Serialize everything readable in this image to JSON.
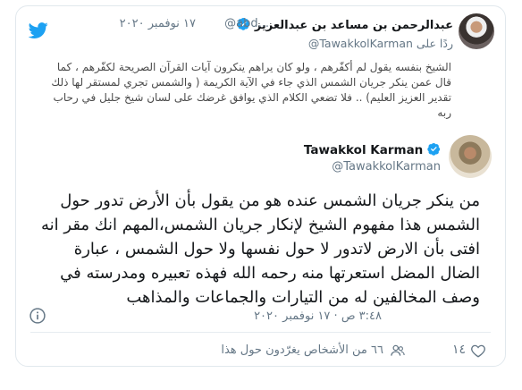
{
  "quoted": {
    "author_name": "عبدالرحمن بن مساعد بن عبدالعزيز",
    "handle": "@abd...",
    "time": "١٧ نوفمبر ٢٠٢٠",
    "replying_label": "ردًا على",
    "replying_handle": "@TawakkolKarman",
    "text": "الشيخ بنفسه يقول لم أكفّرهم ، ولو كان يراهم ينكرون آيات القرآن الصريحة لكفّرهم ، كما قال عمن ينكر جريان الشمس الذي جاء في الآية الكريمة ( والشمس تجري لمستقر لها ذلك تقدير العزيز العليم) .. فلا تضعي الكلام الذي يوافق غرضك على لسان شيخ جليل في رحاب ربه"
  },
  "tweet": {
    "author_name": "Tawakkol Karman",
    "handle": "@TawakkolKarman",
    "text": "من ينكر جريان الشمس عنده هو من يقول بأن الأرض تدور حول الشمس هذا مفهوم الشيخ لإنكار جريان الشمس،المهم انك مقر انه افتى بأن الارض لاتدور لا حول نفسها ولا حول الشمس ، عبارة الضال المضل استعرتها منه رحمه الله فهذه تعبيره ومدرسته في وصف المخالفين له من التيارات والجماعات والمذاهب",
    "time": "٣:٤٨ ص · ١٧ نوفمبر ٢٠٢٠"
  },
  "actions": {
    "likes": "١٤",
    "people_talking": "٦٦ من الأشخاص يغرّدون حول هذا"
  },
  "colors": {
    "accent": "#1da1f2",
    "muted": "#657786",
    "like": "#e0245e"
  },
  "icons": [
    "twitter-bird-icon",
    "verified-badge-icon",
    "info-icon",
    "heart-icon",
    "people-icon"
  ]
}
